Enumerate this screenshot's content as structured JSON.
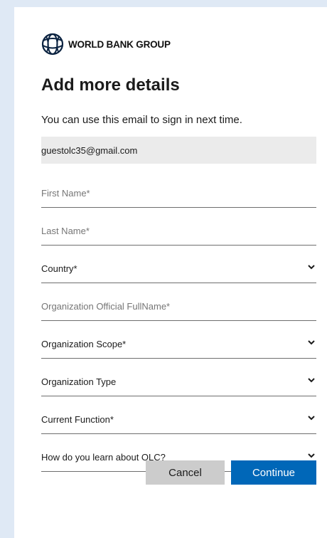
{
  "brand": {
    "name": "WORLD BANK GROUP",
    "logo_icon": "globe-icon"
  },
  "heading": "Add more details",
  "description": "You can use this email to sign in next time.",
  "email": "guestolc35@gmail.com",
  "fields": {
    "first_name": {
      "placeholder": "First Name*"
    },
    "last_name": {
      "placeholder": "Last Name*"
    },
    "country": {
      "label": "Country*"
    },
    "org_fullname": {
      "placeholder": "Organization Official FullName*"
    },
    "org_scope": {
      "label": "Organization Scope*"
    },
    "org_type": {
      "label": "Organization Type"
    },
    "current_function": {
      "label": "Current Function*"
    },
    "learn_about": {
      "label": "How do you learn about OLC?"
    }
  },
  "buttons": {
    "cancel": "Cancel",
    "continue": "Continue"
  },
  "colors": {
    "primary": "#0067b8",
    "page_bg": "#dfe9f5",
    "email_bg": "#ebebeb"
  }
}
